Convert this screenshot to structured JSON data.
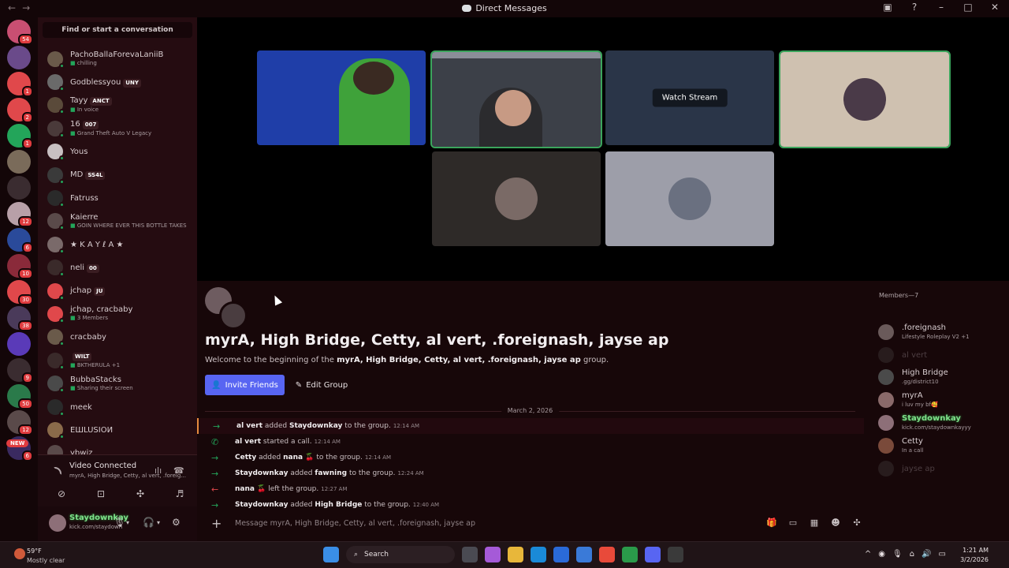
{
  "titlebar": {
    "title": "Direct Messages",
    "back": "←",
    "forward": "→"
  },
  "servers": [
    {
      "color": "#c94f72",
      "badge": "54"
    },
    {
      "color": "#6a4a8a",
      "badge": ""
    },
    {
      "color": "#e0484b",
      "badge": "1"
    },
    {
      "color": "#e0484b",
      "badge": "2"
    },
    {
      "color": "#23a55a",
      "badge": "1"
    },
    {
      "color": "#7a6b5a",
      "badge": ""
    },
    {
      "color": "#3a2c30",
      "badge": ""
    },
    {
      "color": "#b8a0a8",
      "badge": "12"
    },
    {
      "color": "#2a4a9a",
      "badge": "6"
    },
    {
      "color": "#8a2a3a",
      "badge": "10"
    },
    {
      "color": "#e0484b",
      "badge": "30"
    },
    {
      "color": "#4a3a5a",
      "badge": "38"
    },
    {
      "color": "#5a3ab8",
      "badge": ""
    },
    {
      "color": "#3a2c30",
      "badge": "9"
    },
    {
      "color": "#2a7a4a",
      "badge": "50"
    },
    {
      "color": "#5a4a4a",
      "badge": "12"
    },
    {
      "color": "#3a2a60",
      "badge": "6"
    }
  ],
  "servers_new": "NEW",
  "search": {
    "placeholder": "Find or start a conversation"
  },
  "dms": [
    {
      "name": "PachoBallaForevaLaniiB",
      "tag": "",
      "sub": "chilling",
      "color": "#6a5a4a"
    },
    {
      "name": "Godblessyou",
      "tag": "UNY",
      "sub": "",
      "color": "#6a6a6a"
    },
    {
      "name": "Tayy",
      "tag": "ANCT",
      "sub": "In voice",
      "color": "#5a4a3a"
    },
    {
      "name": "16",
      "tag": "007",
      "sub": "Grand Theft Auto V Legacy",
      "color": "#4a3a3a"
    },
    {
      "name": "Yous",
      "tag": "",
      "sub": "",
      "color": "#c8c0c2"
    },
    {
      "name": "MD",
      "tag": "SS4L",
      "sub": "",
      "color": "#3a3a3a"
    },
    {
      "name": "Fatruss",
      "tag": "",
      "sub": "",
      "color": "#2a2a2a"
    },
    {
      "name": "Kaierre",
      "tag": "",
      "sub": "GOIN WHERE EVER THIS BOTTLE TAKES",
      "color": "#5a4a4a"
    },
    {
      "name": "★ K A Y ℓ A ★",
      "tag": "",
      "sub": "",
      "color": "#7a6a6a"
    },
    {
      "name": "neli",
      "tag": "00",
      "sub": "",
      "color": "#3a2a2a"
    },
    {
      "name": "jchap",
      "tag": "JU",
      "sub": "",
      "color": "#e0484b"
    },
    {
      "name": "jchap, cracbaby",
      "tag": "",
      "sub": "3 Members",
      "color": "#e0484b"
    },
    {
      "name": "cracbaby",
      "tag": "",
      "sub": "",
      "color": "#6a5a4a"
    },
    {
      "name": "",
      "tag": "WILT",
      "sub": "BKTHERULA +1",
      "color": "#3a2a2a"
    },
    {
      "name": "BubbaStacks",
      "tag": "",
      "sub": "Sharing their screen",
      "color": "#4a4a4a"
    },
    {
      "name": "meek",
      "tag": "",
      "sub": "",
      "color": "#2a2a2a"
    },
    {
      "name": "ЕШLUSIOИ",
      "tag": "",
      "sub": "",
      "color": "#8a6a4a"
    },
    {
      "name": "ybwiz",
      "tag": "",
      "sub": "",
      "color": "#5a4a4a"
    }
  ],
  "voice": {
    "status": "Video Connected",
    "channel": "myrA, High Bridge, Cetty, al vert, .foreig..."
  },
  "user": {
    "name": "Staydownkay",
    "status": "kick.com/staydown"
  },
  "video_tiles": [
    {
      "bg": "#1f3ea8",
      "speaking": false,
      "label": ""
    },
    {
      "bg": "#3c4048",
      "speaking": true,
      "label": ""
    },
    {
      "bg": "#2a3548",
      "speaking": false,
      "label": "Watch Stream"
    },
    {
      "bg": "#cfc1b0",
      "speaking": true,
      "label": ""
    },
    {
      "bg": "#2e2a28",
      "speaking": false,
      "label": ""
    },
    {
      "bg": "#9d9ea9",
      "speaking": false,
      "label": ""
    }
  ],
  "group": {
    "title": "myrA, High Bridge, Cetty, al vert, .foreignash, jayse ap",
    "welcome_prefix": "Welcome to the beginning of the",
    "welcome_name": "myrA, High Bridge, Cetty, al vert, .foreignash, jayse ap",
    "welcome_suffix": "group.",
    "invite_label": "Invite Friends",
    "edit_label": "Edit Group"
  },
  "date_divider": "March 2, 2026",
  "messages": [
    {
      "icon": "→",
      "kind": "in",
      "actor": "al vert",
      "verb": "added",
      "target": "Staydownkay",
      "rest": "to the group.",
      "time": "12:14 AM"
    },
    {
      "icon": "✆",
      "kind": "call",
      "actor": "al vert",
      "verb": "started a call.",
      "target": "",
      "rest": "",
      "time": "12:14 AM"
    },
    {
      "icon": "→",
      "kind": "in",
      "actor": "Cetty",
      "verb": "added",
      "target": "nana 🍒",
      "rest": "to the group.",
      "time": "12:14 AM"
    },
    {
      "icon": "→",
      "kind": "in",
      "actor": "Staydownkay",
      "verb": "added",
      "target": "fawning",
      "rest": "to the group.",
      "time": "12:24 AM"
    },
    {
      "icon": "←",
      "kind": "out",
      "actor": "nana 🍒",
      "verb": "left the group.",
      "target": "",
      "rest": "",
      "time": "12:27 AM"
    },
    {
      "icon": "→",
      "kind": "in",
      "actor": "Staydownkay",
      "verb": "added",
      "target": "High Bridge",
      "rest": "to the group.",
      "time": "12:40 AM"
    }
  ],
  "composer": {
    "placeholder": "Message myrA, High Bridge, Cetty, al vert, .foreignash, jayse ap"
  },
  "members": {
    "header": "Members—7",
    "list": [
      {
        "name": ".foreignash",
        "desc": "Lifestyle Roleplay V2 +1",
        "online": true,
        "color": "#6a5a5a"
      },
      {
        "name": "al vert",
        "desc": "",
        "online": false,
        "color": "#5a5a5a"
      },
      {
        "name": "High Bridge",
        "desc": ".gg/district10",
        "online": true,
        "color": "#4a4a4a"
      },
      {
        "name": "myrA",
        "desc": "i luv my bf🥰",
        "online": true,
        "color": "#8a6a6a"
      },
      {
        "name": "Staydownkay",
        "desc": "kick.com/staydownkayyy",
        "online": true,
        "color": "#8d6f78"
      },
      {
        "name": "Cetty",
        "desc": "In a call",
        "online": true,
        "color": "#7a4a3a"
      },
      {
        "name": "jayse ap",
        "desc": "",
        "online": false,
        "color": "#5a5a5a"
      }
    ]
  },
  "taskbar": {
    "weather_temp": "59°F",
    "weather_desc": "Mostly clear",
    "weather_badge": "5",
    "search_label": "Search",
    "time": "1:21 AM",
    "date": "3/2/2026"
  }
}
